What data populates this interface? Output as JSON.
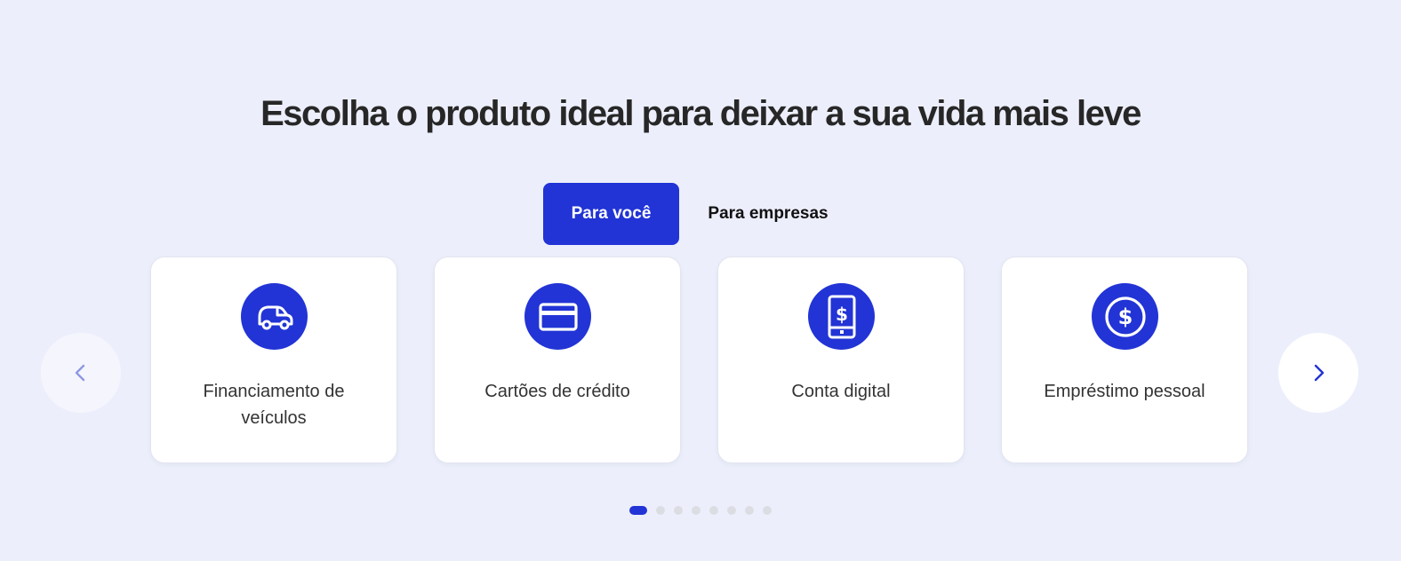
{
  "section": {
    "title": "Escolha o produto ideal para deixar a sua vida mais leve"
  },
  "tabs": [
    {
      "label": "Para você",
      "active": true
    },
    {
      "label": "Para empresas",
      "active": false
    }
  ],
  "cards": [
    {
      "label": "Financiamento de veículos",
      "icon": "car-icon"
    },
    {
      "label": "Cartões de crédito",
      "icon": "credit-card-icon"
    },
    {
      "label": "Conta digital",
      "icon": "mobile-dollar-icon"
    },
    {
      "label": "Empréstimo pessoal",
      "icon": "dollar-coin-icon"
    }
  ],
  "carousel": {
    "prev_icon": "chevron-left-icon",
    "next_icon": "chevron-right-icon",
    "slides_total": 8,
    "active_slide": 1
  },
  "colors": {
    "background": "#eceffb",
    "accent": "#2234d5",
    "card_background": "#ffffff",
    "title_text": "#272727"
  }
}
